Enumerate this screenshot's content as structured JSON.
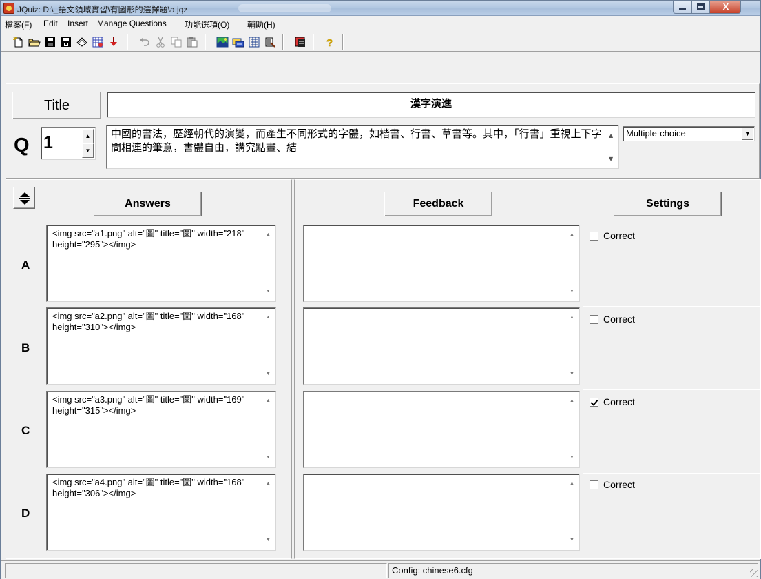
{
  "window": {
    "title": "JQuiz: D:\\_語文領域實習\\有圖形的選擇題\\a.jqz",
    "controls": [
      "minimize",
      "maximize",
      "close"
    ],
    "close_glyph": "X"
  },
  "menu": {
    "items": [
      {
        "label": "檔案(F)"
      },
      {
        "label": "Edit"
      },
      {
        "label": "Insert"
      },
      {
        "label": "Manage Questions"
      },
      {
        "label": "功能選項(O)"
      },
      {
        "label": "輔助(H)"
      }
    ]
  },
  "toolbar": {
    "icons": [
      "new-file-icon",
      "open-folder-icon",
      "save-icon",
      "save-as-icon",
      "clear-icon",
      "web-page-icon",
      "export-icon",
      "undo-icon",
      "cut-icon",
      "copy-icon",
      "paste-icon",
      "add-picture-icon",
      "add-link-icon",
      "insert-icon",
      "config-icon",
      "font-icon",
      "help-icon"
    ]
  },
  "editor": {
    "title_button": "Title",
    "title_value": "漢字演進",
    "q_label": "Q",
    "q_number": "1",
    "question_text": "中國的書法，歷經朝代的演變，而產生不同形式的字體，如楷書、行書、草書等。其中，「行書」重視上下字間相連的筆意，書體自由，講究點畫、結",
    "question_type": "Multiple-choice"
  },
  "headers": {
    "answers": "Answers",
    "feedback": "Feedback",
    "settings": "Settings"
  },
  "answers": [
    {
      "letter": "A",
      "text": "<img src=\"a1.png\" alt=\"圖\" title=\"圖\" width=\"218\" height=\"295\"></img>",
      "feedback": "",
      "correct_label": "Correct",
      "correct": false
    },
    {
      "letter": "B",
      "text": "<img src=\"a2.png\" alt=\"圖\" title=\"圖\" width=\"168\" height=\"310\"></img>",
      "feedback": "",
      "correct_label": "Correct",
      "correct": false
    },
    {
      "letter": "C",
      "text": "<img src=\"a3.png\" alt=\"圖\" title=\"圖\" width=\"169\" height=\"315\"></img>",
      "feedback": "",
      "correct_label": "Correct",
      "correct": true
    },
    {
      "letter": "D",
      "text": "<img src=\"a4.png\" alt=\"圖\" title=\"圖\" width=\"168\" height=\"306\"></img>",
      "feedback": "",
      "correct_label": "Correct",
      "correct": false
    }
  ],
  "status": {
    "config": "Config: chinese6.cfg"
  }
}
